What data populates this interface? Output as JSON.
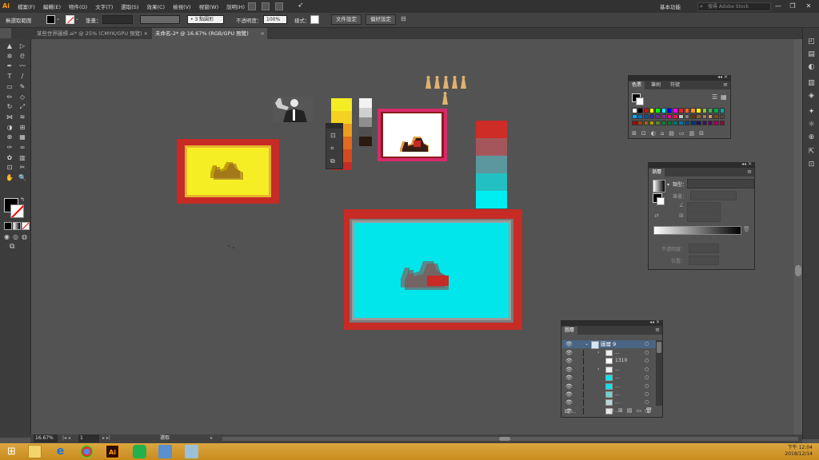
{
  "app": {
    "logo": "Ai"
  },
  "menubar": {
    "menus": [
      "檔案(F)",
      "編輯(E)",
      "物件(O)",
      "文字(T)",
      "選取(S)",
      "效果(C)",
      "檢視(V)",
      "視窗(W)",
      "說明(H)"
    ],
    "workspace": "基本功能",
    "search_placeholder": "搜尋 Adobe Stock",
    "window_controls": {
      "minimize": "—",
      "restore": "❐",
      "close": "✕"
    }
  },
  "controlbar": {
    "selection_label": "無選取範圍",
    "stroke_label": "筆畫：",
    "brush": "3 點圓形",
    "opacity_label": "不透明度：",
    "opacity_value": "100%",
    "style_label": "樣式：",
    "doc_setup": "文件設定",
    "preferences": "偏好設定"
  },
  "tabs": [
    {
      "label": "某些世界圖標.ai* @ 25% (CMYK/GPU 預覽)",
      "active": false
    },
    {
      "label": "未命名-2* @ 16.67% (RGB/GPU 預覽)",
      "active": true
    }
  ],
  "tab_close": "×",
  "tools": [
    "selection-tool",
    "direct-selection-tool",
    "magic-wand-tool",
    "lasso-tool",
    "pen-tool",
    "curvature-tool",
    "type-tool",
    "line-tool",
    "rectangle-tool",
    "paintbrush-tool",
    "pencil-tool",
    "eraser-tool",
    "rotate-tool",
    "scale-tool",
    "width-tool",
    "warp-tool",
    "shape-builder-tool",
    "perspective-tool",
    "mesh-tool",
    "gradient-tool",
    "eyedropper-tool",
    "blend-tool",
    "symbol-sprayer-tool",
    "graph-tool",
    "artboard-tool",
    "slice-tool",
    "hand-tool",
    "zoom-tool"
  ],
  "tool_glyphs": [
    "▲",
    "▷",
    "✲",
    "ᘓ",
    "✒",
    "〰",
    "T",
    "/",
    "▭",
    "✎",
    "✏",
    "◇",
    "↻",
    "⤢",
    "⋈",
    "≋",
    "◑",
    "⊞",
    "⊕",
    "▦",
    "✑",
    "∞",
    "✿",
    "▥",
    "⊡",
    "✂",
    "✋",
    "🔍"
  ],
  "swatches_panel": {
    "tabs": [
      "色票",
      "筆刷",
      "符號"
    ],
    "colors": [
      "#ffffff",
      "#000000",
      "#ff0000",
      "#ffff00",
      "#00ff00",
      "#00ffff",
      "#0000ff",
      "#ff00ff",
      "#ed1c24",
      "#f26522",
      "#f7941d",
      "#fff200",
      "#8dc63f",
      "#39b54a",
      "#00a651",
      "#00a99d",
      "#00aeef",
      "#0072bc",
      "#0054a6",
      "#2e3192",
      "#662d91",
      "#92278f",
      "#ec008c",
      "#ed145b",
      "#c0c0c0",
      "#808080",
      "#603913",
      "#8b5e3c",
      "#a67c52",
      "#c69c6d",
      "#754c24",
      "#534741",
      "#9e0b0f",
      "#a0410d",
      "#a3620a",
      "#aba000",
      "#598527",
      "#1a7b30",
      "#007236",
      "#00746b",
      "#0076a3",
      "#004a80",
      "#003471",
      "#1b1464",
      "#440e62",
      "#630460",
      "#9e005d",
      "#9e0039"
    ]
  },
  "gradient_panel": {
    "title": "漸層",
    "type_label": "類型：",
    "stroke_label": "筆畫：",
    "opacity_label": "不透明度：",
    "position_label": "位置："
  },
  "layers_panel": {
    "title": "圖層",
    "layer_name": "圖層 9",
    "rows": [
      {
        "label": "...",
        "expand": true
      },
      {
        "label": "1310",
        "expand": false
      },
      {
        "label": "...",
        "expand": true
      },
      {
        "label": "...",
        "expand": false
      },
      {
        "label": "...",
        "expand": false
      },
      {
        "label": "...",
        "expand": false
      },
      {
        "label": "...",
        "expand": false
      },
      {
        "label": "...",
        "expand": false
      }
    ],
    "count": "12 ..."
  },
  "statusbar": {
    "zoom": "16.67%",
    "artboard": "1",
    "tool": "選取"
  },
  "taskbar": {
    "time": "下午 12:04",
    "date": "2018/12/14"
  },
  "colors": {
    "red_frame": "#c62b25",
    "yellow": "#f6ee24",
    "cyan": "#00e6ea",
    "pink_frame": "#d62a6a"
  }
}
